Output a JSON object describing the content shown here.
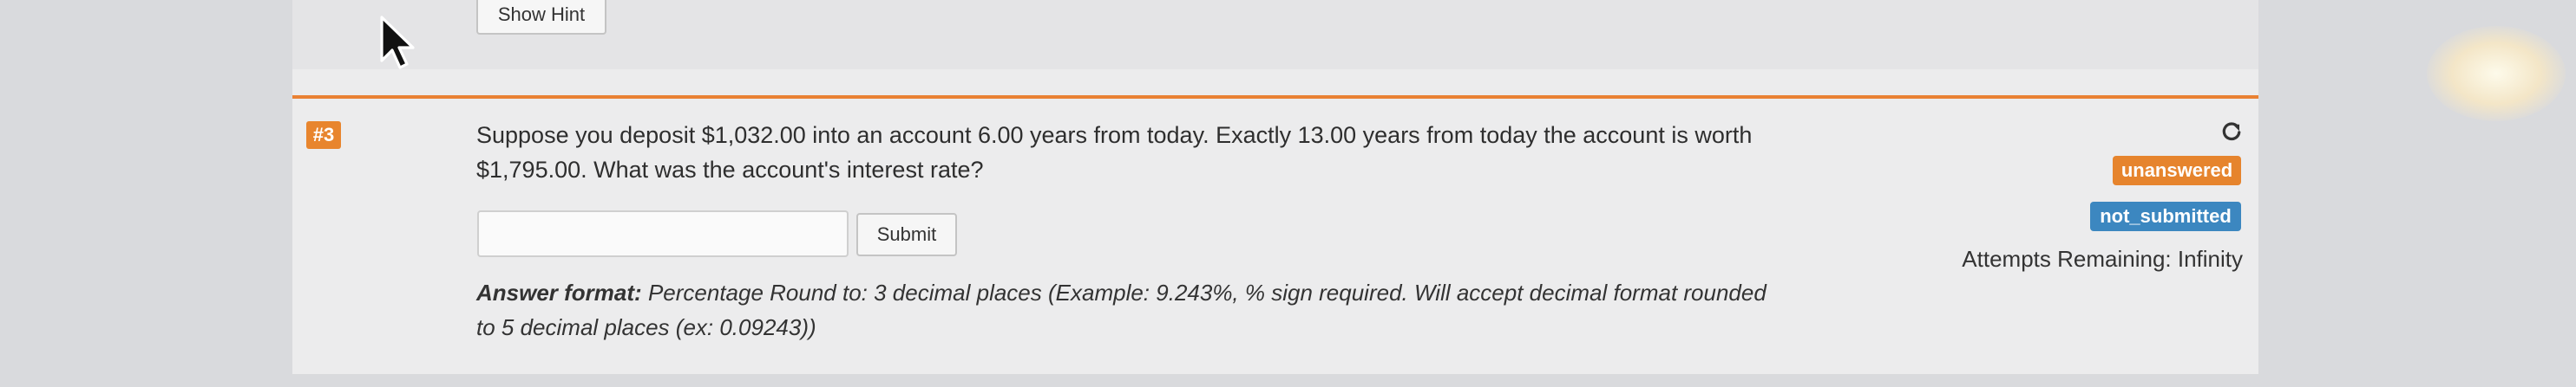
{
  "previous_question": {
    "hint_label": "Show Hint"
  },
  "question": {
    "number": "#3",
    "text": "Suppose you deposit $1,032.00 into an account 6.00 years from today. Exactly 13.00 years from today the account is worth $1,795.00. What was the account's interest rate?",
    "answer_value": "",
    "answer_placeholder": "",
    "submit_label": "Submit",
    "format_label": "Answer format:",
    "format_text": "Percentage Round to: 3 decimal places (Example: 9.243%, % sign required. Will accept decimal format rounded to 5 decimal places (ex: 0.09243))",
    "status_badge": "unanswered",
    "submission_badge": "not_submitted",
    "attempts": "Attempts Remaining: Infinity",
    "refresh_icon": "refresh-icon"
  },
  "colors": {
    "accent_orange": "#e8852e",
    "badge_blue": "#3c87c0"
  }
}
